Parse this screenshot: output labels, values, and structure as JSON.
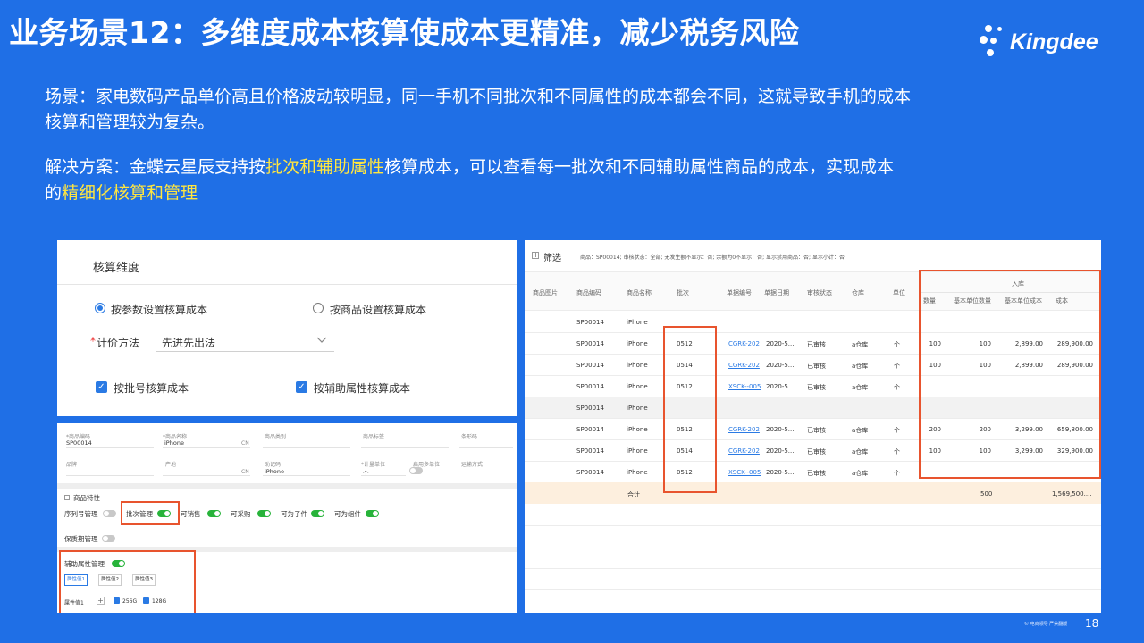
{
  "title": "业务场景12：多维度成本核算使成本更精准，减少税务风险",
  "logo": {
    "word": "Kingdee"
  },
  "scenario": {
    "line1": "场景：家电数码产品单价高且价格波动较明显，同一手机不同批次和不同属性的成本都会不同，这就导致手机的成本",
    "line2": "核算和管理较为复杂。"
  },
  "solution": {
    "part1": "解决方案：金蝶云星辰支持按",
    "hl1": "批次和辅助属性",
    "part2": "核算成本，可以查看每一批次和不同辅助属性商品的成本，实现成本",
    "line2_prefix": "的",
    "hl2": "精细化核算和管理"
  },
  "panel_a": {
    "heading": "核算维度",
    "radio1": "按参数设置核算成本",
    "radio2": "按商品设置核算成本",
    "method_label": "计价方法",
    "required_mark": "*",
    "method_value": "先进先出法",
    "check1": "按批号核算成本",
    "check2": "按辅助属性核算成本"
  },
  "panel_b": {
    "fields": [
      {
        "label": "*商品编码",
        "value": "SP00014",
        "suffix": ""
      },
      {
        "label": "*商品名称",
        "value": "iPhone",
        "suffix": "CN"
      },
      {
        "label": "商品类别",
        "value": "",
        "suffix": ""
      },
      {
        "label": "商品标签",
        "value": "",
        "suffix": ""
      },
      {
        "label": "条形码",
        "value": "",
        "suffix": ""
      },
      {
        "label": "品牌",
        "value": "",
        "suffix": ""
      },
      {
        "label": "产地",
        "value": "",
        "suffix": "CN"
      },
      {
        "label": "助记码",
        "value": "iPhone",
        "suffix": ""
      },
      {
        "label": "*计量单位",
        "value": "个",
        "suffix": ""
      },
      {
        "label": "启用多单位",
        "value": "",
        "suffix": ""
      },
      {
        "label": "运输方式",
        "value": "",
        "suffix": ""
      }
    ],
    "section_title": "商品特性",
    "toggles": [
      {
        "label": "序列号管理",
        "on": false
      },
      {
        "label": "批次管理",
        "on": true
      },
      {
        "label": "可销售",
        "on": true
      },
      {
        "label": "可采购",
        "on": true
      },
      {
        "label": "可为子件",
        "on": true
      },
      {
        "label": "可为组件",
        "on": true
      }
    ],
    "shelf_label": "保质期管理",
    "aux_label": "辅助属性管理",
    "tabs": [
      "属性值1",
      "属性值2",
      "属性值3"
    ],
    "attr_label": "属性值1",
    "attr_values": [
      "256G",
      "128G"
    ]
  },
  "panel_c": {
    "filter_label": "筛选",
    "filter_text": "商品：SP00014; 审核状态：全部; 无发生额不显示：否; 余额为0不显示：否; 显示禁用商品：否; 显示小计：否",
    "group_header": "入库",
    "columns": [
      "商品图片",
      "商品编码",
      "商品名称",
      "批次",
      "单据编号",
      "单据日期",
      "审核状态",
      "仓库",
      "单位",
      "数量",
      "基本单位数量",
      "基本单位成本",
      "成本"
    ],
    "rows": [
      {
        "code": "SP00014",
        "name": "iPhone",
        "batch": "",
        "doc": "",
        "date": "",
        "status": "",
        "wh": "",
        "unit": "",
        "qty": "",
        "bqty": "",
        "bcost": "",
        "cost": "",
        "gray": false
      },
      {
        "code": "SP00014",
        "name": "iPhone",
        "batch": "0512",
        "doc": "CGRK-202",
        "date": "2020-5...",
        "status": "已审核",
        "wh": "a仓库",
        "unit": "个",
        "qty": "100",
        "bqty": "100",
        "bcost": "2,899.00",
        "cost": "289,900.00",
        "gray": false
      },
      {
        "code": "SP00014",
        "name": "iPhone",
        "batch": "0514",
        "doc": "CGRK-202",
        "date": "2020-5...",
        "status": "已审核",
        "wh": "a仓库",
        "unit": "个",
        "qty": "100",
        "bqty": "100",
        "bcost": "2,899.00",
        "cost": "289,900.00",
        "gray": false
      },
      {
        "code": "SP00014",
        "name": "iPhone",
        "batch": "0512",
        "doc": "XSCK--005",
        "date": "2020-5...",
        "status": "已审核",
        "wh": "a仓库",
        "unit": "个",
        "qty": "",
        "bqty": "",
        "bcost": "",
        "cost": "",
        "gray": false
      },
      {
        "code": "SP00014",
        "name": "iPhone",
        "batch": "",
        "doc": "",
        "date": "",
        "status": "",
        "wh": "",
        "unit": "",
        "qty": "",
        "bqty": "",
        "bcost": "",
        "cost": "",
        "gray": true
      },
      {
        "code": "SP00014",
        "name": "iPhone",
        "batch": "0512",
        "doc": "CGRK-202",
        "date": "2020-5...",
        "status": "已审核",
        "wh": "a仓库",
        "unit": "个",
        "qty": "200",
        "bqty": "200",
        "bcost": "3,299.00",
        "cost": "659,800.00",
        "gray": false
      },
      {
        "code": "SP00014",
        "name": "iPhone",
        "batch": "0514",
        "doc": "CGRK-202",
        "date": "2020-5...",
        "status": "已审核",
        "wh": "a仓库",
        "unit": "个",
        "qty": "100",
        "bqty": "100",
        "bcost": "3,299.00",
        "cost": "329,900.00",
        "gray": false
      },
      {
        "code": "SP00014",
        "name": "iPhone",
        "batch": "0512",
        "doc": "XSCK--005",
        "date": "2020-5...",
        "status": "已审核",
        "wh": "a仓库",
        "unit": "个",
        "qty": "",
        "bqty": "",
        "bcost": "",
        "cost": "",
        "gray": false
      }
    ],
    "total": {
      "label": "合计",
      "bqty": "500",
      "cost": "1,569,500...."
    }
  },
  "footer": {
    "copyright": "© 电商领导 严禁翻版",
    "page": "18"
  },
  "colors": {
    "background": "#1f6fe6",
    "highlight": "#ffe640",
    "red_box": "#e8542e",
    "accent": "#2a7ae4",
    "toggle_on": "#27b33a"
  }
}
